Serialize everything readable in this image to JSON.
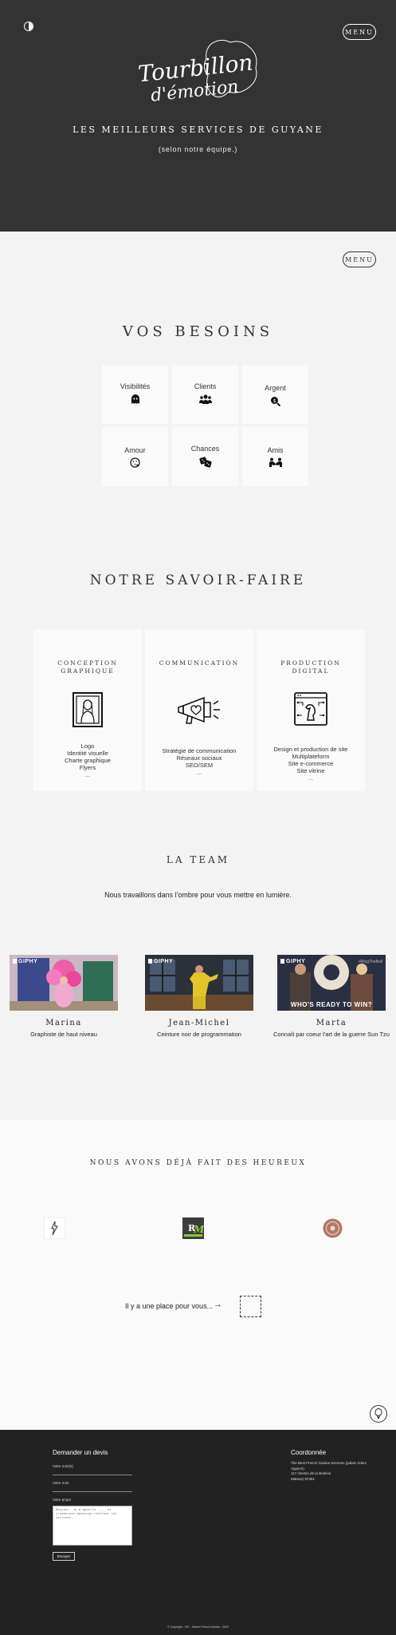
{
  "hero": {
    "menu_label": "MENU",
    "logo_text_line1": "Tourbillon",
    "logo_text_line2": "d'émotion",
    "tagline": "LES MEILLEURS SERVICES DE GUYANE",
    "subtagline": "(selon notre équipe.)"
  },
  "menu2_label": "MENU",
  "needs": {
    "title": "VOS BESOINS",
    "items": [
      {
        "label": "Visibilités",
        "icon": "ghost-icon"
      },
      {
        "label": "Clients",
        "icon": "users-icon"
      },
      {
        "label": "Argent",
        "icon": "money-search-icon"
      },
      {
        "label": "Amour",
        "icon": "kiss-face-icon"
      },
      {
        "label": "Chances",
        "icon": "dice-icon"
      },
      {
        "label": "Amis",
        "icon": "people-hands-icon"
      }
    ]
  },
  "savoir_faire": {
    "title": "NOTRE SAVOIR-FAIRE",
    "cards": [
      {
        "title": "CONCEPTION GRAPHIQUE",
        "icon": "mona-lisa-frame-icon",
        "items": [
          "Logo",
          "Identité visuelle",
          "Charte graphique",
          "Flyers",
          "..."
        ]
      },
      {
        "title": "COMMUNICATION",
        "icon": "megaphone-camera-icon",
        "items": [
          "Stratégie de communication",
          "Réseaux sociaux",
          "SEO/SEM",
          "..."
        ]
      },
      {
        "title": "PRODUCTION DIGITAL",
        "icon": "chess-screen-icon",
        "items": [
          "Design et production de site",
          "Multiplateform",
          "Site e-commerce",
          "Site vitrine",
          "..."
        ]
      }
    ]
  },
  "team": {
    "title": "LA TEAM",
    "subtitle": "Nous travaillons dans l'ombre pour vous mettre en lumière.",
    "giphy_label": "GIPHY",
    "members": [
      {
        "name": "Marina",
        "role": "Graphiste de haut niveau"
      },
      {
        "name": "Jean-Michel",
        "role": "Ceinture noir de programmation"
      },
      {
        "name": "Marta",
        "role": "Connaît par coeur l'art de la guerre Sun Tzu",
        "gif_caption": "WHO'S READY TO WIN?",
        "gif_tag": "#RingTheBell"
      }
    ]
  },
  "happy": {
    "title": "NOUS AVONS DÉJÀ FAIT DES HEUREUX",
    "clients": [
      "lightning-logo",
      "rm-logo",
      "round-seal-logo"
    ],
    "place_text": "Il y a une place pour vous...",
    "arrow": "→"
  },
  "footer": {
    "quote_title": "Demander un devis",
    "fields": [
      "Votre nom(s)",
      "Votre nom",
      "Votre projet"
    ],
    "textarea_placeholder": "Bonjour, Je m'appelle ____ et j'aimerais beaucoup réaliser les services...",
    "send_label": "Envoyer",
    "coord_title": "Coordonnée",
    "coord_lines": [
      "The Best French Guiana Services (jadam riders Appyon)",
      "117 chemin de la Boeline",
      "Matoury 97351"
    ],
    "copyright": "© Copyright - 007 - Glaeim French Guiana - 2022"
  },
  "colors": {
    "hero_bg": "#333333",
    "footer_bg": "#222222",
    "page_bg": "#f3f3f3",
    "card_bg": "#fafafa"
  }
}
